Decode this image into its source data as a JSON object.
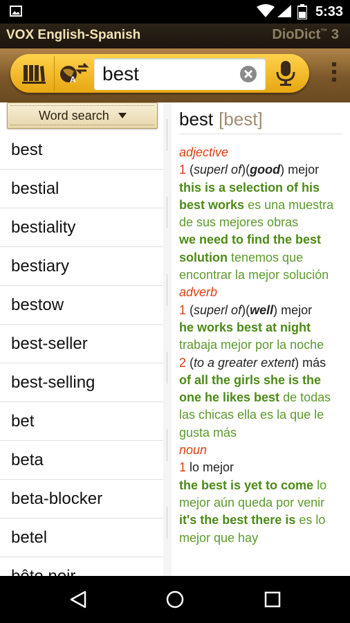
{
  "status_bar": {
    "time": "5:33"
  },
  "title_bar": {
    "title": "VOX English-Spanish",
    "brand": "DioDict",
    "brand_tm": "™",
    "brand_version": "3"
  },
  "search": {
    "value": "best"
  },
  "word_search": {
    "label": "Word search"
  },
  "word_list": [
    "best",
    "bestial",
    "bestiality",
    "bestiary",
    "bestow",
    "best-seller",
    "best-selling",
    "bet",
    "beta",
    "beta-blocker",
    "betel",
    "bête noir"
  ],
  "entry": {
    "headword": "best",
    "pronunciation": "[best]",
    "adj_pos": "adjective",
    "adj_num": "1",
    "adj_gram_open": "(",
    "adj_gram_label": "superl of",
    "adj_gram_mid": ")(",
    "adj_gram_word": "good",
    "adj_gram_close": ")",
    "adj_translation": "mejor",
    "adj_ex1": "this is a selection of his best works",
    "adj_tr1": "es una muestra de sus mejores obras",
    "adj_ex2": "we need to find the best solution",
    "adj_tr2": "tenemos que encontrar la mejor solución",
    "adv_pos": "adverb",
    "adv_num1": "1",
    "adv_gram_open": "(",
    "adv_gram_label": "superl of",
    "adv_gram_mid": ")(",
    "adv_gram_word": "well",
    "adv_gram_close": ")",
    "adv_translation1": "mejor",
    "adv_ex1": "he works best at night",
    "adv_tr1": "trabaja mejor por la noche",
    "adv_num2": "2",
    "adv_gram2_open": "(",
    "adv_gram2_label": "to a greater extent",
    "adv_gram2_close": ")",
    "adv_translation2": "más",
    "adv_ex2": "of all the girls she is the one he likes best",
    "adv_tr2": "de todas las chicas ella es la que le gusta más",
    "noun_pos": "noun",
    "noun_num": "1",
    "noun_translation": "lo mejor",
    "noun_ex1": "the best is yet to come",
    "noun_tr1": "lo mejor aún queda por venir",
    "noun_ex2": "it's the best there is",
    "noun_tr2": "es lo mejor que hay"
  },
  "colors": {
    "accent_red": "#e03c12",
    "example_green": "#4c8a16",
    "toolbar_gold": "#f2bb2b"
  }
}
